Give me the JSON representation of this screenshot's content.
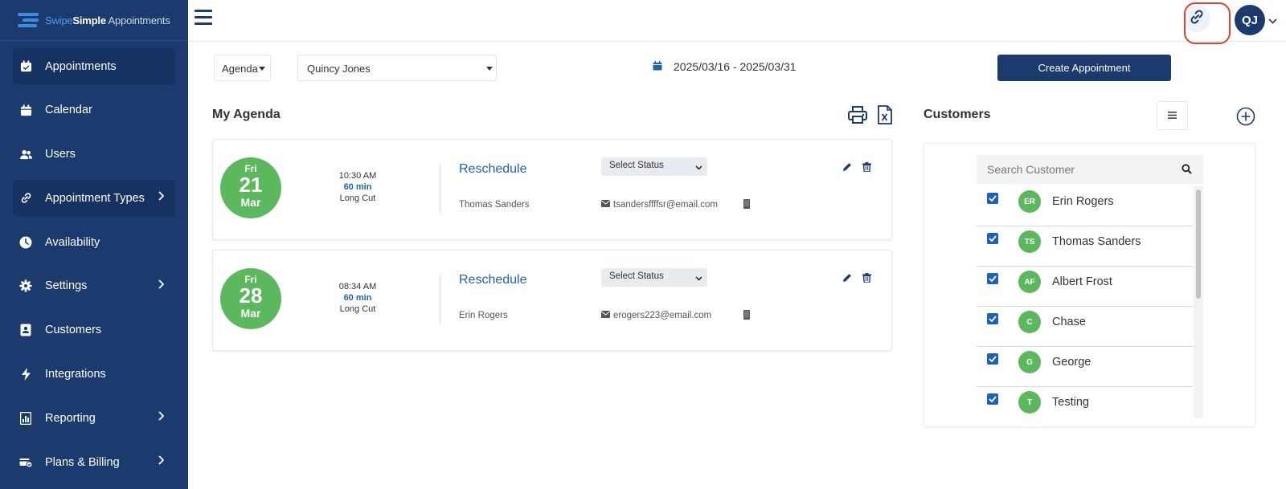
{
  "brand": {
    "part1": "Swipe",
    "part2": "Simple",
    "part3": " Appointments"
  },
  "sidebar": {
    "items": [
      {
        "label": "Appointments",
        "icon": "calendar-check-icon"
      },
      {
        "label": "Calendar",
        "icon": "calendar-icon"
      },
      {
        "label": "Users",
        "icon": "users-icon"
      },
      {
        "label": "Appointment Types",
        "icon": "link-icon"
      },
      {
        "label": "Availability",
        "icon": "clock-icon"
      },
      {
        "label": "Settings",
        "icon": "gear-icon"
      },
      {
        "label": "Customers",
        "icon": "contact-card-icon"
      },
      {
        "label": "Integrations",
        "icon": "bolt-icon"
      },
      {
        "label": "Reporting",
        "icon": "report-icon"
      },
      {
        "label": "Plans & Billing",
        "icon": "billing-icon"
      }
    ]
  },
  "topbar": {
    "avatar_initials": "QJ"
  },
  "toolbar": {
    "view_label": "Agenda",
    "staff_value": "Quincy Jones",
    "date_range": "2025/03/16 - 2025/03/31",
    "create_label": "Create Appointment"
  },
  "agenda": {
    "title": "My Agenda",
    "appointments": [
      {
        "weekday": "Fri",
        "day": "21",
        "month": "Mar",
        "time": "10:30 AM",
        "duration": "60 min",
        "service": "Long Cut",
        "action": "Reschedule",
        "customer": "Thomas Sanders",
        "status_placeholder": "Select Status",
        "email": "tsandersffffsr@email.com"
      },
      {
        "weekday": "Fri",
        "day": "28",
        "month": "Mar",
        "time": "08:34 AM",
        "duration": "60 min",
        "service": "Long Cut",
        "action": "Reschedule",
        "customer": "Erin Rogers",
        "status_placeholder": "Select Status",
        "email": "erogers223@email.com"
      }
    ]
  },
  "customers": {
    "title": "Customers",
    "search_placeholder": "Search Customer",
    "list": [
      {
        "initials": "ER",
        "name": "Erin Rogers",
        "checked": true
      },
      {
        "initials": "TS",
        "name": "Thomas Sanders",
        "checked": true
      },
      {
        "initials": "AF",
        "name": "Albert Frost",
        "checked": true
      },
      {
        "initials": "C",
        "name": "Chase",
        "checked": true
      },
      {
        "initials": "G",
        "name": "George",
        "checked": true
      },
      {
        "initials": "T",
        "name": "Testing",
        "checked": true
      }
    ]
  },
  "colors": {
    "sidebar": "#1b3a6e",
    "accent_blue": "#1d62b7",
    "green": "#5cb85c",
    "highlight_ring": "#e0412b"
  }
}
